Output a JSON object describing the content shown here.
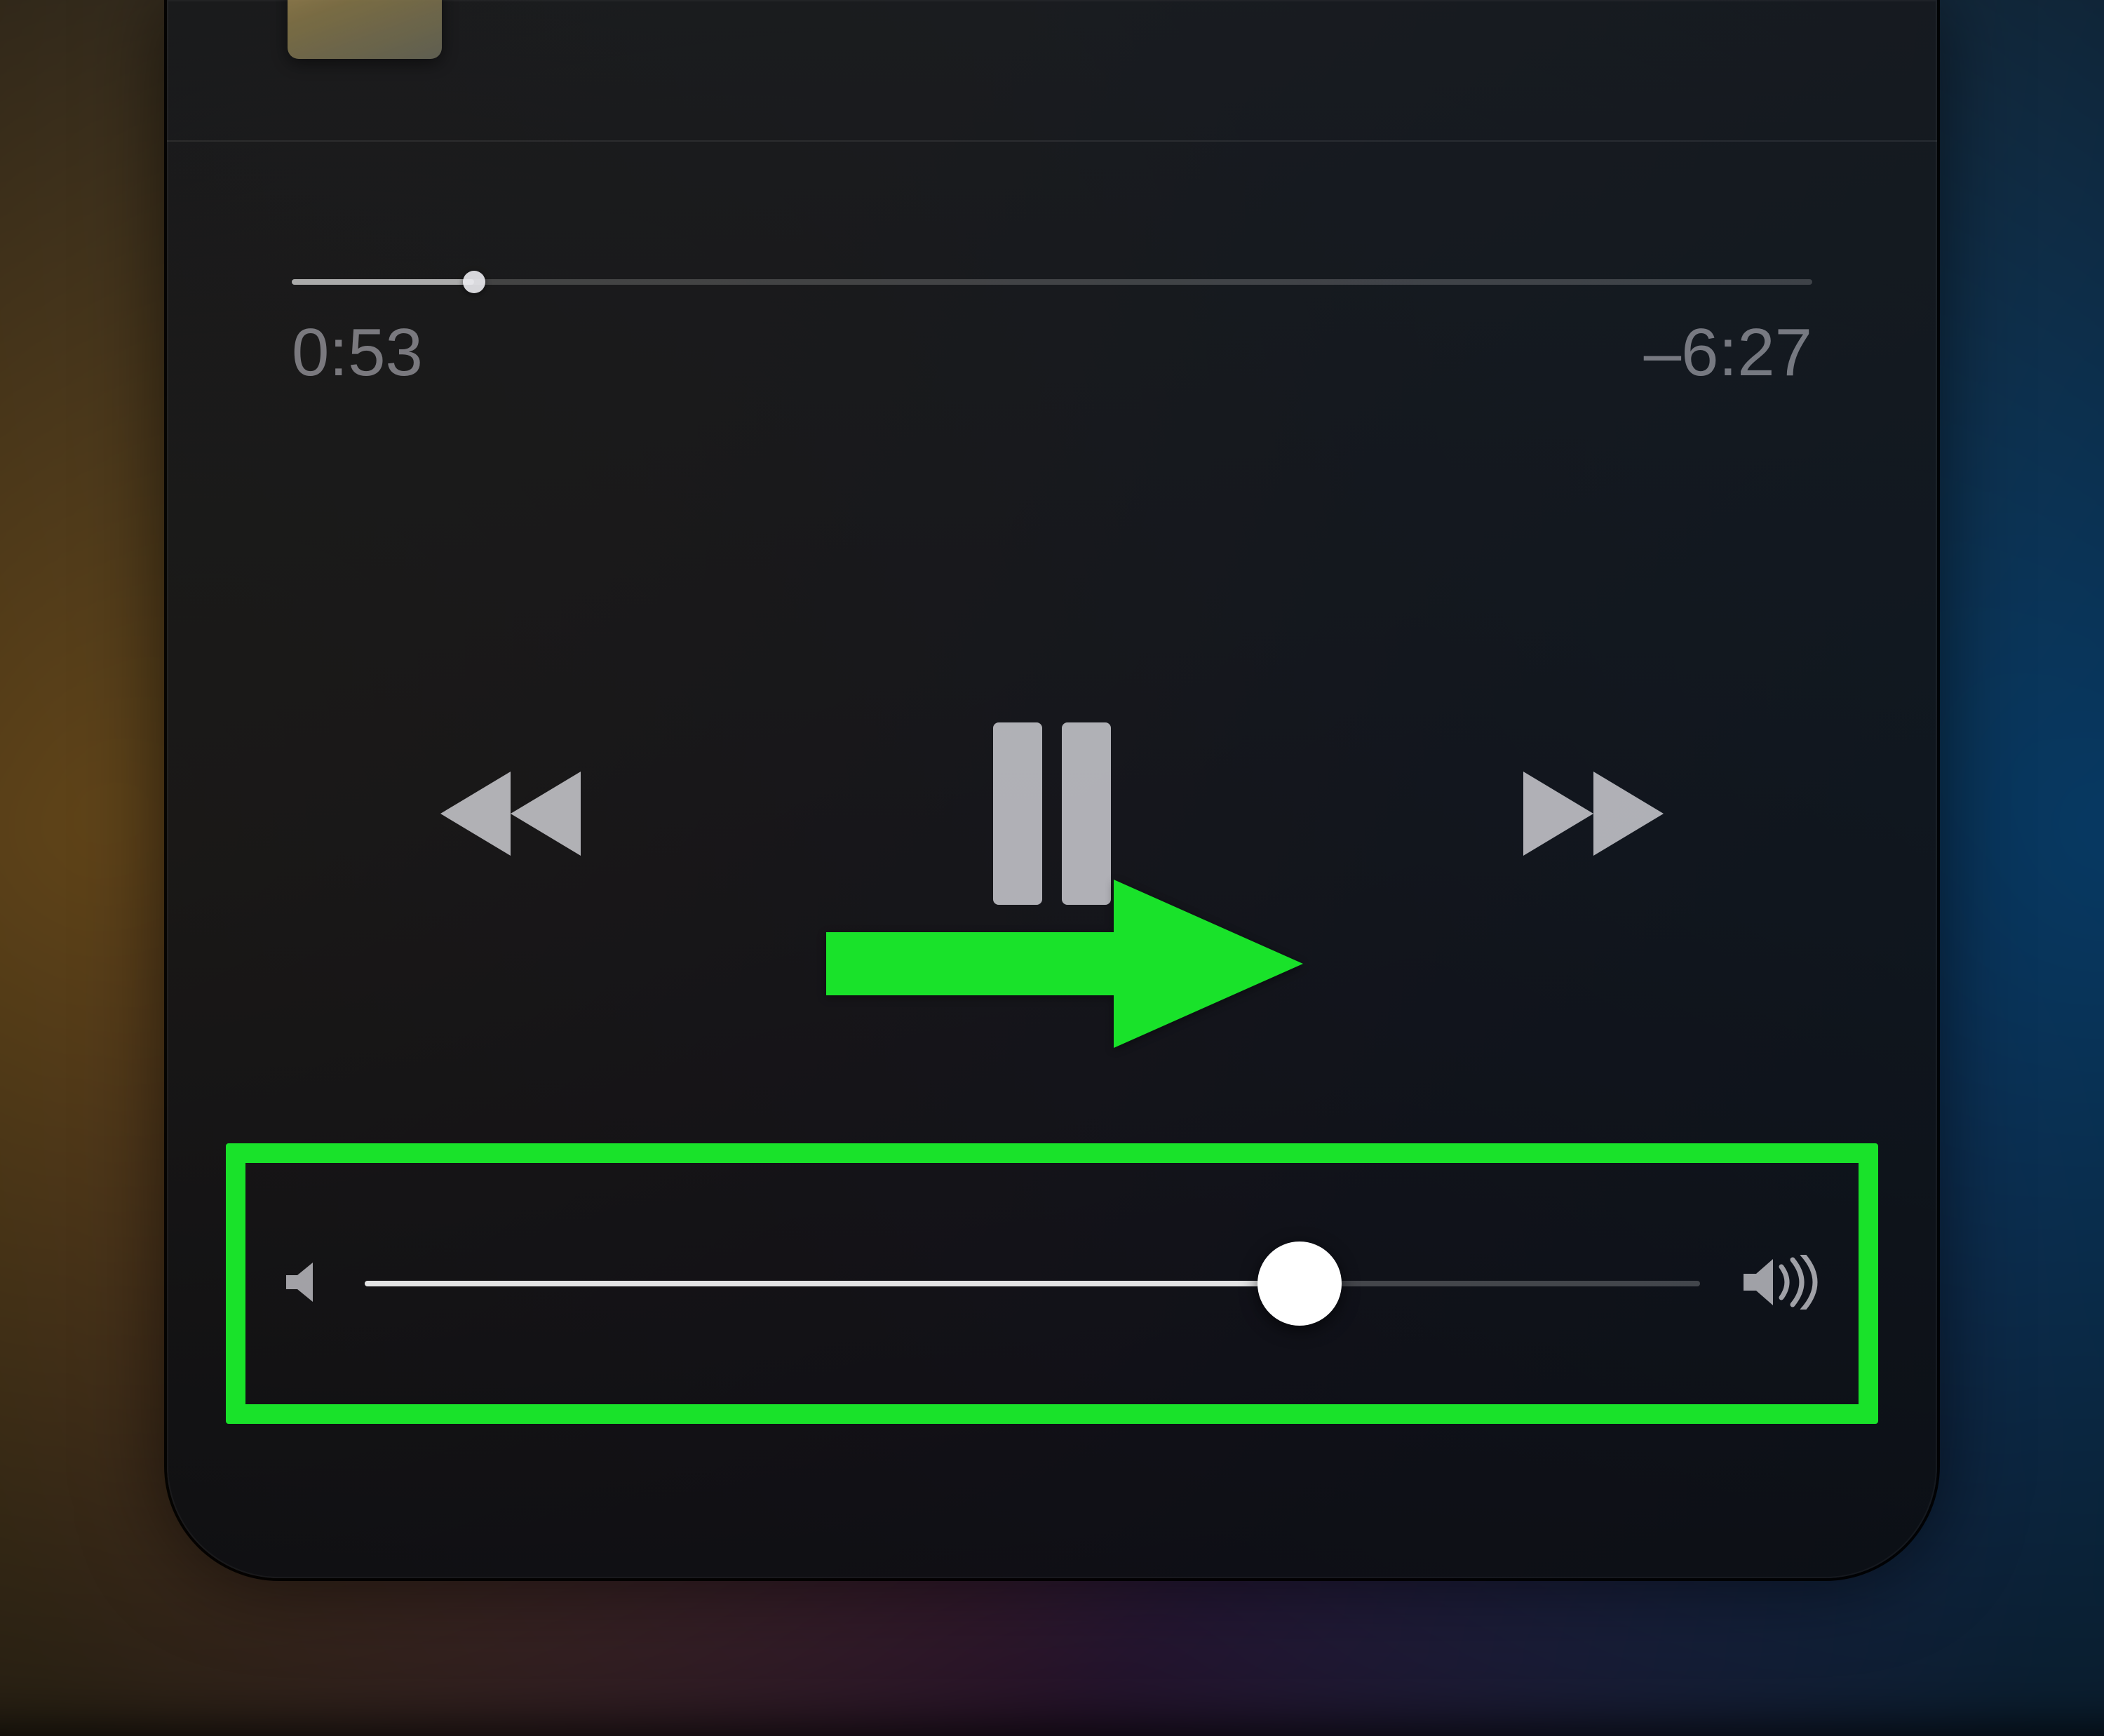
{
  "player": {
    "scrubber": {
      "elapsed_label": "0:53",
      "remaining_label": "–6:27",
      "progress_pct": 12
    },
    "transport": {
      "state": "playing"
    },
    "volume": {
      "level_pct": 70
    }
  },
  "annotation": {
    "highlight_color": "#19e22a"
  }
}
